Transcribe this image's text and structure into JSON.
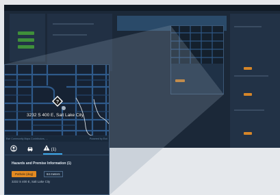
{
  "popup": {
    "address": "3232 S 400 E, Salt Lake City",
    "attribution_left": "Esri Community Maps Contributors, ...",
    "attribution_right": "Powered by Esri",
    "tabs": [
      {
        "icon": "person-icon",
        "label": ""
      },
      {
        "icon": "car-icon",
        "label": ""
      },
      {
        "icon": "hazard-icon",
        "label": "(1)"
      }
    ],
    "section_title": "Hazards and Premise Information (1)",
    "hazard_badge": "Pothole (dog)",
    "distance_badge": "64 meters",
    "hazard_address": "3232 S 400 E, Salt Lake City"
  },
  "colors": {
    "accent": "#3da7e8",
    "warning": "#e38a21",
    "panel": "#1e2e42",
    "map_road": "#2f5a8a"
  }
}
